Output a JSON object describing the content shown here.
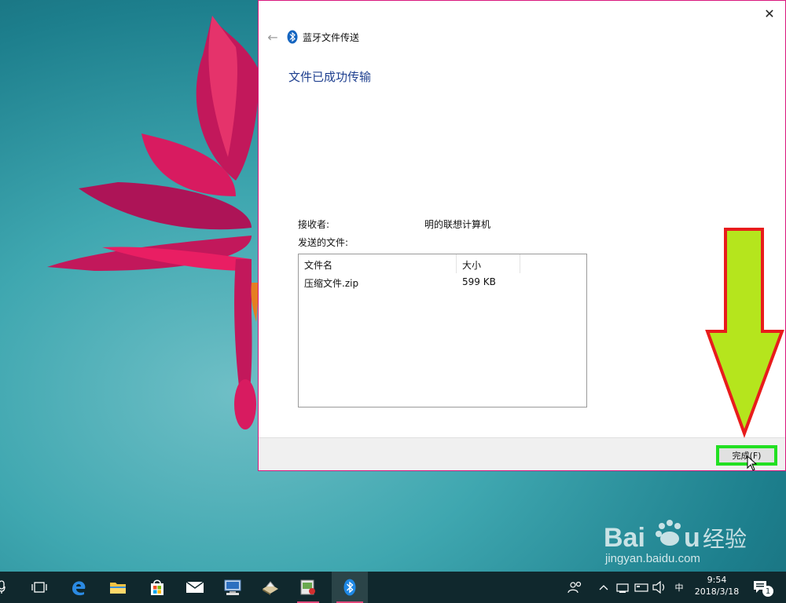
{
  "dialog": {
    "title": "蓝牙文件传送",
    "heading": "文件已成功传输",
    "receiver_label": "接收者:",
    "receiver_value": "明的联想计算机",
    "files_label": "发送的文件:",
    "columns": [
      "文件名",
      "大小"
    ],
    "files": [
      {
        "name": "压缩文件.zip",
        "size": "599 KB"
      }
    ],
    "finish_label": "完成(F)"
  },
  "taskbar": {
    "ime_label": "中",
    "time": "9:54",
    "date": "2018/3/18",
    "notification_count": "1"
  },
  "watermark": {
    "text": "Baidu经验",
    "url": "jingyan.baidu.com"
  },
  "colors": {
    "accent_title": "#1e3f8f",
    "highlight_box": "#22e022",
    "arrow_fill": "#b5e51d",
    "arrow_stroke": "#e81c1c",
    "dialog_border": "#d9177d"
  }
}
